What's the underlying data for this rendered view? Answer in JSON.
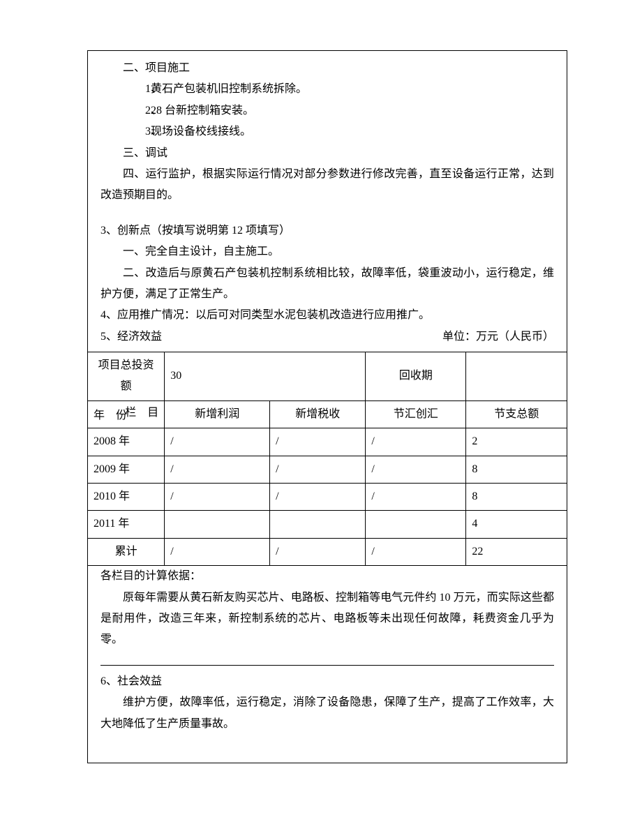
{
  "section2": {
    "heading": "二、项目施工",
    "items": [
      {
        "num": "1、",
        "text": "黄石产包装机旧控制系统拆除。"
      },
      {
        "num": "2、",
        "text": "28 台新控制箱安装。"
      },
      {
        "num": "3、",
        "text": "现场设备校线接线。"
      }
    ]
  },
  "section3": {
    "heading": "三、调试",
    "para": "四、运行监护，根据实际运行情况对部分参数进行修改完善，直至设备运行正常，达到改造预期目的。"
  },
  "point3": {
    "heading": "3、创新点（按填写说明第 12 项填写）",
    "items": [
      "一、完全自主设计，自主施工。",
      "二、改造后与原黄石产包装机控制系统相比较，故障率低，袋重波动小，运行稳定，维护方便，满足了正常生产。"
    ]
  },
  "point4": "4、应用推广情况：以后可对同类型水泥包装机改造进行应用推广。",
  "point5": {
    "heading": "5、经济效益",
    "unit": "单位：万元（人民币）",
    "table": {
      "row1": {
        "label": "项目总投资额",
        "value": "30",
        "label2": "回收期",
        "value2": ""
      },
      "header": {
        "diag_top": "栏 目",
        "diag_bottom": "年 份",
        "c1": "新增利润",
        "c2": "新增税收",
        "c3": "节汇创汇",
        "c4": "节支总额"
      },
      "rows": [
        {
          "year": "2008 年",
          "c1": "/",
          "c2": "/",
          "c3": "/",
          "c4": "2"
        },
        {
          "year": "2009 年",
          "c1": "/",
          "c2": "/",
          "c3": "/",
          "c4": "8"
        },
        {
          "year": "2010 年",
          "c1": "/",
          "c2": "/",
          "c3": "/",
          "c4": "8"
        },
        {
          "year": "2011 年",
          "c1": "",
          "c2": "",
          "c3": "",
          "c4": "4"
        },
        {
          "year": "累计",
          "c1": "/",
          "c2": "/",
          "c3": "/",
          "c4": "22"
        }
      ]
    },
    "basis_heading": "各栏目的计算依据：",
    "basis_text": "原每年需要从黄石新友购买芯片、电路板、控制箱等电气元件约 10 万元，而实际这些都是耐用件，改造三年来，新控制系统的芯片、电路板等未出现任何故障，耗费资金几乎为零。"
  },
  "point6": {
    "heading": "6、社会效益",
    "text": "维护方便，故障率低，运行稳定，消除了设备隐患，保障了生产，提高了工作效率，大大地降低了生产质量事故。"
  }
}
